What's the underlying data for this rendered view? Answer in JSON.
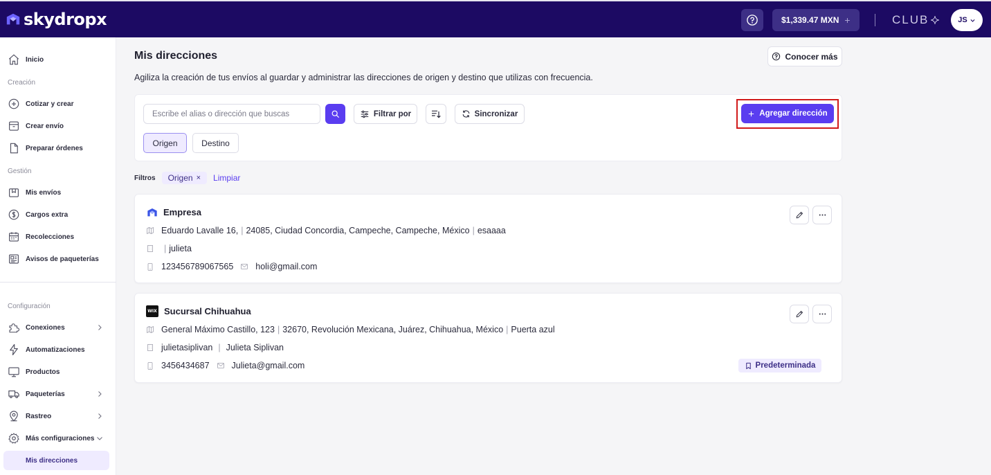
{
  "topbar": {
    "logo_text": "skydropx",
    "balance": "$1,339.47 MXN",
    "balance_plus": "+",
    "club_label": "CLUB",
    "user_initials": "JS"
  },
  "sidebar": {
    "inicio": "Inicio",
    "section_creacion": "Creación",
    "cotizar": "Cotizar y crear",
    "crear_envio": "Crear envío",
    "preparar": "Preparar órdenes",
    "section_gestion": "Gestión",
    "mis_envios": "Mis envíos",
    "cargos": "Cargos extra",
    "recolecciones": "Recolecciones",
    "avisos": "Avisos de paqueterías",
    "section_config": "Configuración",
    "conexiones": "Conexiones",
    "automatizaciones": "Automatizaciones",
    "productos": "Productos",
    "paqueterias": "Paqueterías",
    "rastreo": "Rastreo",
    "mas_config": "Más configuraciones",
    "mis_direcciones": "Mis direcciones"
  },
  "main": {
    "title": "Mis direcciones",
    "conocer_mas": "Conocer más",
    "subtitle": "Agiliza la creación de tus envíos al guardar y administrar las direcciones de origen y destino que utilizas con frecuencia.",
    "search_placeholder": "Escribe el alias o dirección que buscas",
    "filtrar_por": "Filtrar por",
    "sincronizar": "Sincronizar",
    "agregar_direccion": "Agregar dirección",
    "toggle_origen": "Origen",
    "toggle_destino": "Destino",
    "filters_label": "Filtros",
    "active_filter": "Origen",
    "chip_close": "×",
    "limpiar": "Limpiar"
  },
  "addresses": [
    {
      "name": "Empresa",
      "street": "Eduardo Lavalle 16,",
      "location": "24085, Ciudad Concordia, Campeche, Campeche, México",
      "reference": "esaaaa",
      "company": "",
      "contact": "julieta",
      "phone": "123456789067565",
      "email": "holi@gmail.com"
    },
    {
      "name": "Sucursal Chihuahua",
      "brand_badge": "WIX",
      "street": "General Máximo Castillo, 123",
      "location": "32670, Revolución Mexicana, Juárez, Chihuahua, México",
      "reference": "Puerta azul",
      "company": "julietasiplivan",
      "contact": "Julieta Siplivan",
      "phone": "3456434687",
      "email": "Julieta@gmail.com",
      "default_label": "Predeterminada"
    }
  ],
  "separators": {
    "pipe": "|"
  },
  "colors": {
    "topbar_bg": "#1c0a63",
    "primary": "#5a3df0",
    "highlight_box": "#d11a1a",
    "active_bg": "#efebff"
  }
}
